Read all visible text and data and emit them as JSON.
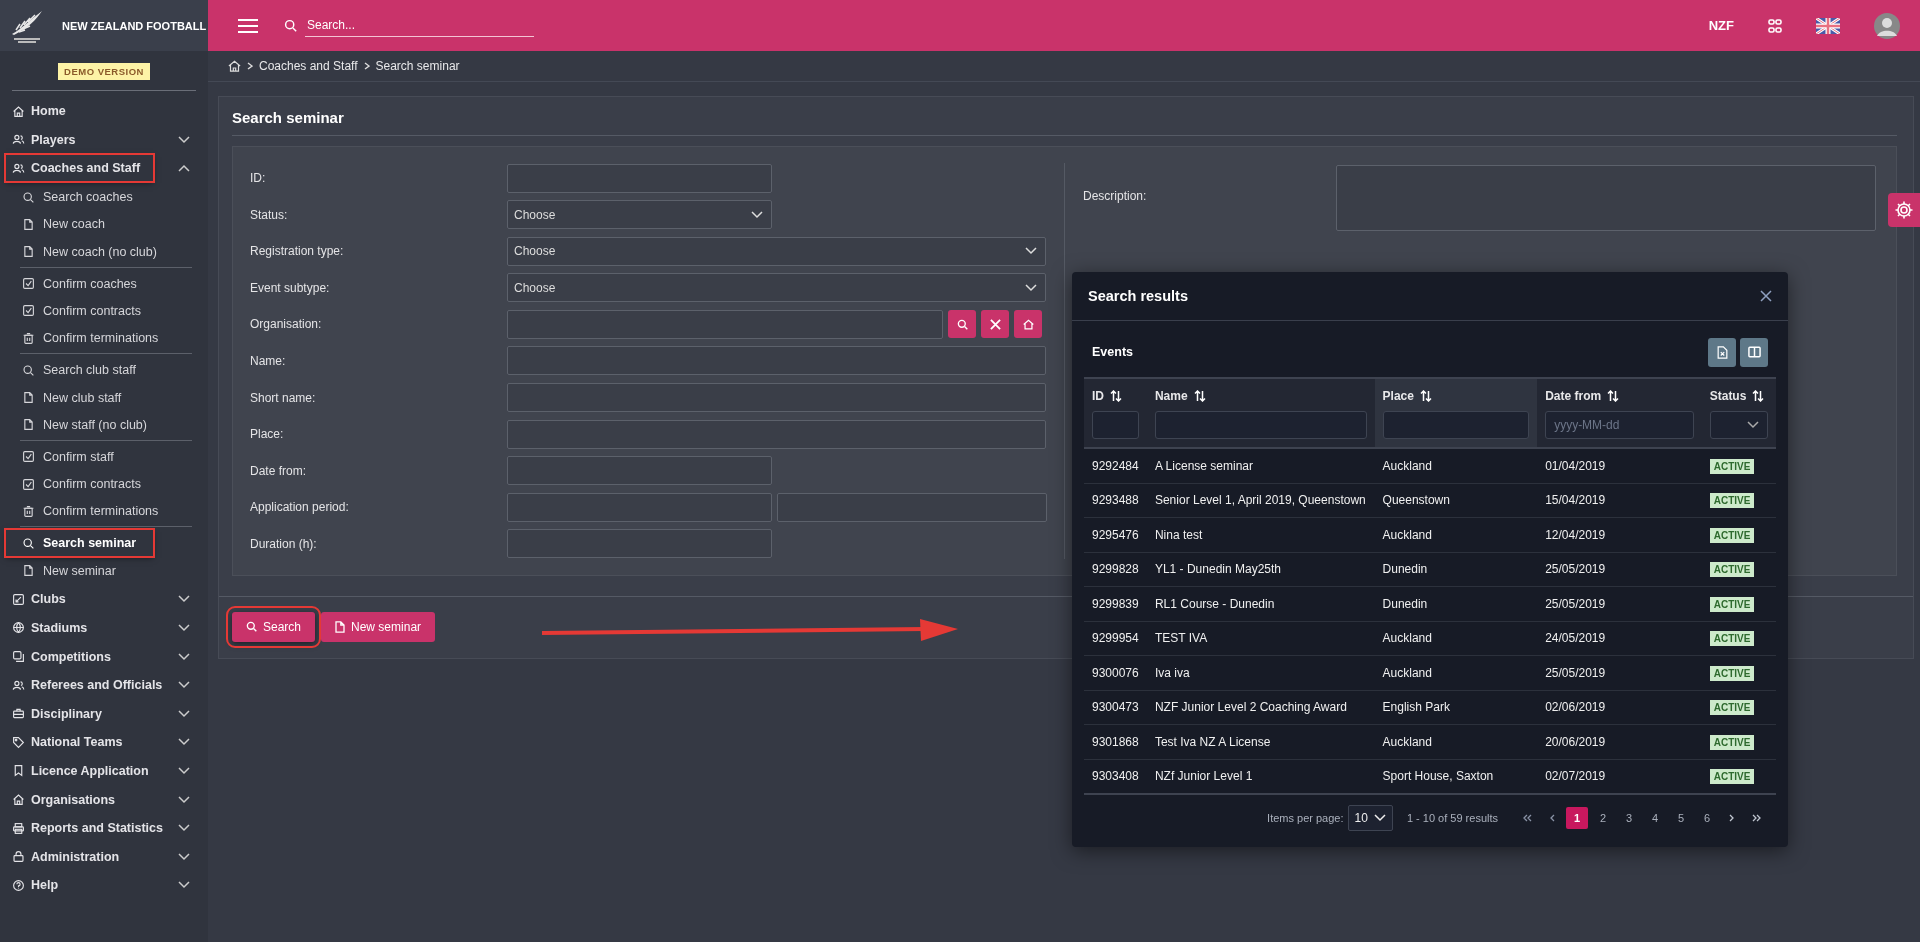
{
  "brand": {
    "name": "NEW ZEALAND FOOTBALL",
    "badge": "DEMO VERSION"
  },
  "topbar": {
    "search_placeholder": "Search...",
    "org": "NZF"
  },
  "sidebar": {
    "items": [
      {
        "label": "Home",
        "annotated": false
      },
      {
        "label": "Players",
        "expanded": false,
        "annotated": false
      },
      {
        "label": "Coaches and Staff",
        "expanded": true,
        "annotated": true,
        "children": [
          {
            "items": [
              {
                "label": "Search coaches",
                "kind": "search",
                "selected": false,
                "annotated": false
              },
              {
                "label": "New coach",
                "kind": "new",
                "selected": false,
                "annotated": false
              },
              {
                "label": "New coach (no club)",
                "kind": "new",
                "selected": false,
                "annotated": false
              }
            ]
          },
          {
            "items": [
              {
                "label": "Confirm coaches",
                "kind": "confirm",
                "selected": false,
                "annotated": false
              },
              {
                "label": "Confirm contracts",
                "kind": "confirm",
                "selected": false,
                "annotated": false
              },
              {
                "label": "Confirm terminations",
                "kind": "terminate",
                "selected": false,
                "annotated": false
              }
            ]
          },
          {
            "items": [
              {
                "label": "Search club staff",
                "kind": "search",
                "selected": false,
                "annotated": false
              },
              {
                "label": "New club staff",
                "kind": "new",
                "selected": false,
                "annotated": false
              },
              {
                "label": "New staff (no club)",
                "kind": "new",
                "selected": false,
                "annotated": false
              }
            ]
          },
          {
            "items": [
              {
                "label": "Confirm staff",
                "kind": "confirm",
                "selected": false,
                "annotated": false
              },
              {
                "label": "Confirm contracts",
                "kind": "confirm",
                "selected": false,
                "annotated": false
              },
              {
                "label": "Confirm terminations",
                "kind": "terminate",
                "selected": false,
                "annotated": false
              }
            ]
          },
          {
            "items": [
              {
                "label": "Search seminar",
                "kind": "search",
                "selected": true,
                "annotated": true
              },
              {
                "label": "New seminar",
                "kind": "new",
                "selected": false,
                "annotated": false
              }
            ]
          }
        ]
      },
      {
        "label": "Clubs",
        "expanded": false,
        "annotated": false
      },
      {
        "label": "Stadiums",
        "expanded": false,
        "annotated": false
      },
      {
        "label": "Competitions",
        "expanded": false,
        "annotated": false
      },
      {
        "label": "Referees and Officials",
        "expanded": false,
        "annotated": false
      },
      {
        "label": "Disciplinary",
        "expanded": false,
        "annotated": false
      },
      {
        "label": "National Teams",
        "expanded": false,
        "annotated": false
      },
      {
        "label": "Licence Application",
        "expanded": false,
        "annotated": false
      },
      {
        "label": "Organisations",
        "expanded": false,
        "annotated": false
      },
      {
        "label": "Reports and Statistics",
        "expanded": false,
        "annotated": false
      },
      {
        "label": "Administration",
        "expanded": false,
        "annotated": false
      },
      {
        "label": "Help",
        "expanded": false,
        "annotated": false
      }
    ]
  },
  "breadcrumb": [
    "Coaches and Staff",
    "Search seminar"
  ],
  "page_title": "Search seminar",
  "form": {
    "fields": [
      {
        "label": "ID:",
        "kind": "textshort"
      },
      {
        "label": "Status:",
        "kind": "selectshort",
        "value": "Choose"
      },
      {
        "label": "Registration type:",
        "kind": "select",
        "value": "Choose"
      },
      {
        "label": "Event subtype:",
        "kind": "select",
        "value": "Choose"
      },
      {
        "label": "Organisation:",
        "kind": "lookup"
      },
      {
        "label": "Name:",
        "kind": "text"
      },
      {
        "label": "Short name:",
        "kind": "text"
      },
      {
        "label": "Place:",
        "kind": "text"
      },
      {
        "label": "Date from:",
        "kind": "textshort"
      },
      {
        "label": "Application period:",
        "kind": "range"
      },
      {
        "label": "Duration (h):",
        "kind": "textshort"
      }
    ],
    "description_label": "Description:"
  },
  "buttons": [
    {
      "label": "Search",
      "kind": "search",
      "annotated": true
    },
    {
      "label": "New seminar",
      "kind": "new",
      "annotated": false
    }
  ],
  "dialog": {
    "title": "Search results",
    "table_title": "Events",
    "columns": [
      {
        "label": "ID",
        "kind": "text",
        "sorted": false
      },
      {
        "label": "Name",
        "kind": "text",
        "sorted": false
      },
      {
        "label": "Place",
        "kind": "text",
        "sorted": true
      },
      {
        "label": "Date from",
        "kind": "date",
        "placeholder": "yyyy-MM-dd",
        "sorted": false
      },
      {
        "label": "Status",
        "kind": "select",
        "sorted": false
      }
    ],
    "rows": [
      [
        "9292484",
        "A License seminar",
        "Auckland",
        "01/04/2019",
        "ACTIVE"
      ],
      [
        "9293488",
        "Senior Level 1, April 2019, Queenstown",
        "Queenstown",
        "15/04/2019",
        "ACTIVE"
      ],
      [
        "9295476",
        "Nina test",
        "Auckland",
        "12/04/2019",
        "ACTIVE"
      ],
      [
        "9299828",
        "YL1 - Dunedin May25th",
        "Dunedin",
        "25/05/2019",
        "ACTIVE"
      ],
      [
        "9299839",
        "RL1 Course - Dunedin",
        "Dunedin",
        "25/05/2019",
        "ACTIVE"
      ],
      [
        "9299954",
        "TEST IVA",
        "Auckland",
        "24/05/2019",
        "ACTIVE"
      ],
      [
        "9300076",
        "Iva iva",
        "Auckland",
        "25/05/2019",
        "ACTIVE"
      ],
      [
        "9300473",
        "NZF Junior Level 2 Coaching Award",
        "English Park",
        "02/06/2019",
        "ACTIVE"
      ],
      [
        "9301868",
        "Test Iva NZ A License",
        "Auckland",
        "20/06/2019",
        "ACTIVE"
      ],
      [
        "9303408",
        "NZf Junior Level 1",
        "Sport House, Saxton",
        "02/07/2019",
        "ACTIVE"
      ]
    ],
    "pagination": {
      "items_label": "Items per page:",
      "per_page": "10",
      "range": "1 - 10 of 59 results",
      "pages": [
        {
          "label": "1",
          "selected": true
        },
        {
          "label": "2",
          "selected": false
        },
        {
          "label": "3",
          "selected": false
        },
        {
          "label": "4",
          "selected": false
        },
        {
          "label": "5",
          "selected": false
        },
        {
          "label": "6",
          "selected": false
        }
      ]
    }
  }
}
